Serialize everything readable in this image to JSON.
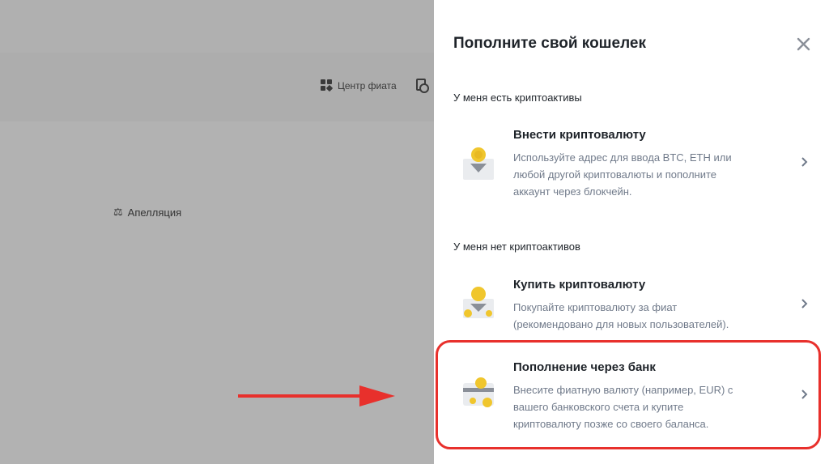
{
  "background": {
    "fiat_center_label": "Центр фиата",
    "appeal_label": "Апелляция"
  },
  "drawer": {
    "title": "Пополните свой кошелек",
    "section_have": "У меня есть криптоактивы",
    "section_have_not": "У меня нет криптоактивов",
    "options": [
      {
        "title": "Внести криптовалюту",
        "desc_lines": [
          "Используйте адрес для ввода BTC, ETH или",
          "любой другой криптовалюты и пополните",
          "аккаунт через блокчейн."
        ]
      },
      {
        "title": "Купить криптовалюту",
        "desc_lines": [
          "Покупайте криптовалюту за фиат",
          "(рекомендовано для новых пользователей)."
        ]
      },
      {
        "title": "Пополнение через банк",
        "desc_lines": [
          "Внесите фиатную валюту (например, EUR) с",
          "вашего банковского счета и купите",
          "криптовалюту позже со своего баланса."
        ]
      }
    ]
  },
  "colors": {
    "annotation_red": "#e8302c",
    "coin_yellow": "#f0c62d",
    "muted_text": "#707a8a"
  }
}
